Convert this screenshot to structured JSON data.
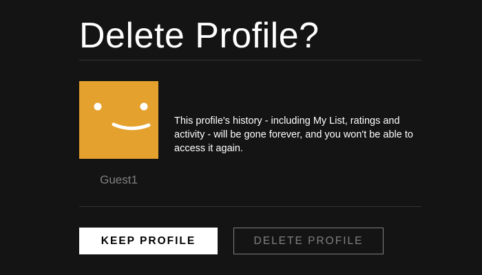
{
  "dialog": {
    "title": "Delete Profile?",
    "message": "This profile's history - including My List, ratings and activity - will be gone forever, and you won't be able to access it again."
  },
  "profile": {
    "name": "Guest1",
    "avatar_icon": "smiley-face-icon",
    "avatar_color": "#e5a12d"
  },
  "actions": {
    "keep_label": "KEEP PROFILE",
    "delete_label": "DELETE PROFILE"
  },
  "colors": {
    "background": "#141414",
    "text_primary": "#ffffff",
    "text_muted": "#808080",
    "divider": "#333333"
  }
}
